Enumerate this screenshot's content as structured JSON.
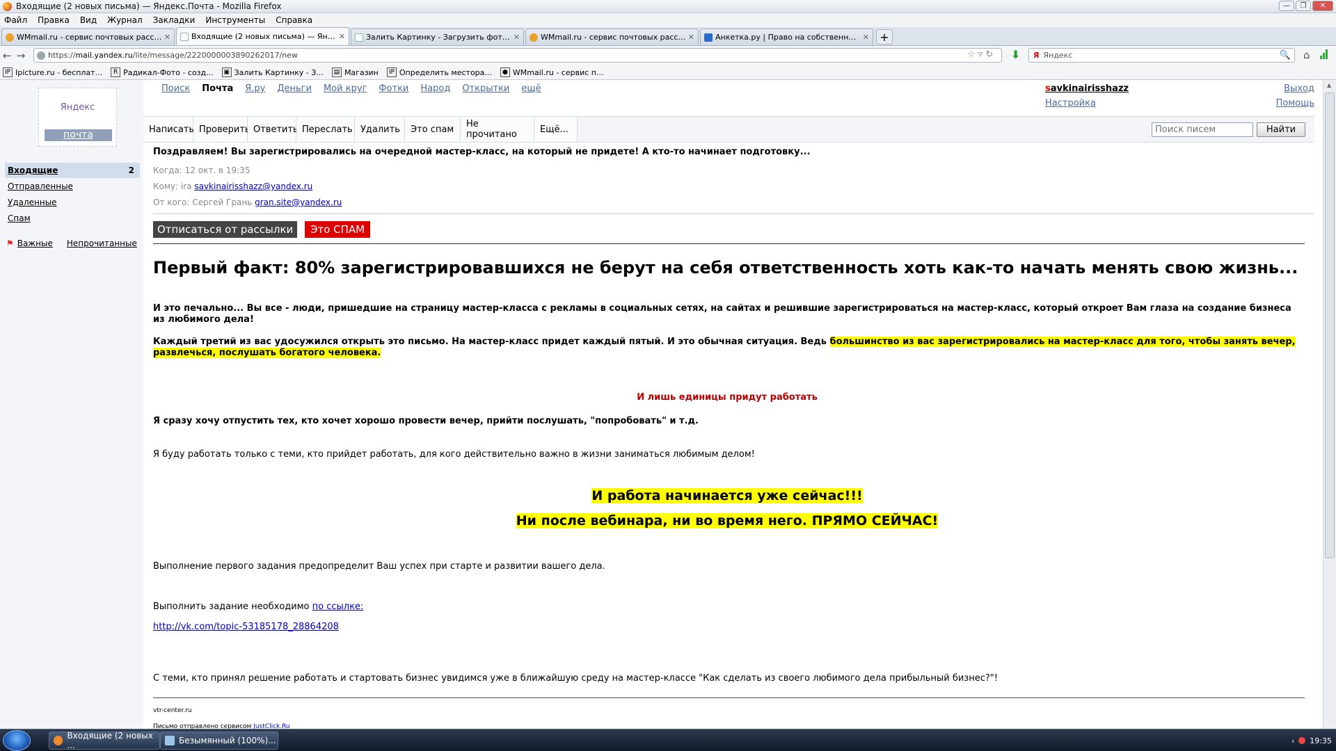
{
  "window": {
    "title": "Входящие (2 новых письма) — Яндекс.Почта - Mozilla Firefox",
    "buttons": {
      "min": "—",
      "max": "❐",
      "close": "✕"
    }
  },
  "menu": [
    "Файл",
    "Правка",
    "Вид",
    "Журнал",
    "Закладки",
    "Инструменты",
    "Справка"
  ],
  "tabs": [
    {
      "label": "WMmail.ru - сервис почтовых рассылок...",
      "icon": "wmmail-icon",
      "active": false
    },
    {
      "label": "Входящие (2 новых письма) — Яндекс...",
      "icon": "yandex-icon",
      "active": true
    },
    {
      "label": "Залить Картинку - Загрузить фото - Ф...",
      "icon": "upload-icon",
      "active": false
    },
    {
      "label": "WMmail.ru - сервис почтовых рассылок...",
      "icon": "wmmail-icon",
      "active": false
    },
    {
      "label": "Анкетка.ру | Право на собственное мн...",
      "icon": "anketka-icon",
      "active": false
    }
  ],
  "tab_close": "✕",
  "new_tab": "+",
  "nav": {
    "back": "←",
    "forward": "→",
    "url_prefix": "https://",
    "url_domain": "mail.yandex.ru",
    "url_path": "/lite/message/2220000003890262017/new",
    "star": "☆ ▿ ↻",
    "download": "⬇",
    "search_logo": "Я",
    "search_placeholder": "Яндекс",
    "magnifier": "🔍",
    "home": "⌂"
  },
  "bookmarks": [
    {
      "label": "Ipicture.ru - бесплат...",
      "icon": "IP"
    },
    {
      "label": "Радикал-Фото - созд...",
      "icon": "R"
    },
    {
      "label": "Залить Картинку - З...",
      "icon": "▣"
    },
    {
      "label": "Магазин",
      "icon": "▤"
    },
    {
      "label": "Определить месторa...",
      "icon": "IP"
    },
    {
      "label": "WMmail.ru - сервис п...",
      "icon": "●"
    }
  ],
  "logo": {
    "top": "Яндекс",
    "bottom": "почта"
  },
  "services": [
    "Поиск",
    "Почта",
    "Я.ру",
    "Деньги",
    "Мой круг",
    "Фотки",
    "Народ",
    "Открытки",
    "ещё"
  ],
  "user": {
    "first_letter": "s",
    "rest": "avkinairisshazz",
    "settings": "Настройка"
  },
  "right_links": {
    "exit": "Выход",
    "help": "Помощь"
  },
  "folders": [
    {
      "label": "Входящие",
      "count": "2",
      "selected": true
    },
    {
      "label": "Отправленные",
      "count": "",
      "selected": false
    },
    {
      "label": "Удаленные",
      "count": "",
      "selected": false
    },
    {
      "label": "Спам",
      "count": "",
      "selected": false
    }
  ],
  "marks": {
    "flag": "⚑",
    "important": "Важные",
    "unread": "Непрочитанные"
  },
  "toolbar": {
    "buttons": [
      "Написать",
      "Проверить",
      "Ответить",
      "Переслать",
      "Удалить",
      "Это спам",
      "Не прочитано",
      "Ещё..."
    ],
    "search_placeholder": "Поиск писем",
    "find": "Найти"
  },
  "message": {
    "subject": "Поздравляем! Вы зарегистрировались на очередной мастер-класс, на который не придете! А кто-то начинает подготовку...",
    "when_label": "Когда:",
    "when": "12 окт. в 19:35",
    "to_label": "Кому:",
    "to_name": "ira",
    "to_email": "savkinairisshazz@yandex.ru",
    "from_label": "От кого:",
    "from_name": "Сергей Грань",
    "from_email": "gran.site@yandex.ru"
  },
  "body": {
    "unsubscribe": "Отписаться от рассылки",
    "spam": "Это СПАМ",
    "fact": "Первый факт: 80% зарегистрировавшихся не берут на себя ответственность хоть как-то начать менять свою жизнь...",
    "p1": "И это печально... Вы все - люди, пришедшие на страницу мастер-класса с рекламы в социальных сетях, на сайтах и решившие зарегистрироваться на мастер-класс, который откроет Вам глаза на создание бизнеса из любимого дела!",
    "p2_plain": "Каждый третий из вас удосужился открыть это письмо. На мастер-класс придет каждый пятый. И это обычная ситуация. Ведь ",
    "p2_highlight": "большинство из вас зарегистрировались на мастер-класс для того, чтобы занять вечер, развлечься, послушать богатого человека.",
    "red_line": "И лишь единицы придут работать",
    "p3": "Я сразу хочу отпустить тех, кто хочет хорошо провести вечер, прийти послушать, \"попробовать\" и т.д.",
    "p4": "Я буду работать только с теми, кто прийдет работать, для кого действительно важно в жизни заниматься любимым делом!",
    "now1": "И работа начинается уже сейчас!!!",
    "now2": "Ни после вебинара, ни во время него. ПРЯМО СЕЙЧАС!",
    "p5": "Выполнение первого задания предопределит Ваш успех при старте и развитии вашего дела.",
    "task_text": "Выполнить задание необходимо ",
    "task_link": "по ссылке:",
    "vk_link": "http://vk.com/topic-53185178_28864208",
    "p6": "С теми, кто принял решение работать и стартовать бизнес увидимся уже в ближайшую среду на мастер-классе \"Как сделать из своего любимого дела прибыльный бизнес?\"!",
    "footer1": "vtr-center.ru",
    "footer2_text": "Письмо отправлено сервисом ",
    "footer2_link": "JustClick.Ru"
  },
  "taskbar": {
    "tasks": [
      "Входящие (2 новых ...",
      "Безымянный (100%)..."
    ],
    "time": "19:35"
  }
}
